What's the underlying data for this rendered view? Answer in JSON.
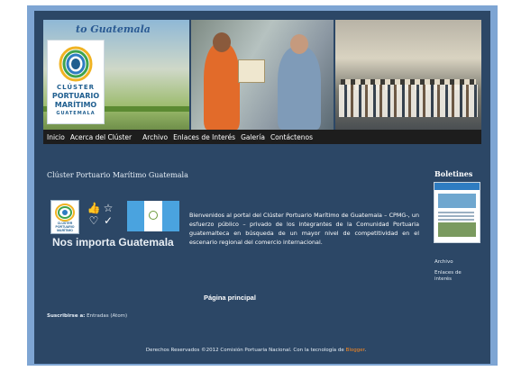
{
  "banner": {
    "sign_text": "to Guatemala",
    "logo_lines": [
      "CLÚSTER",
      "PORTUARIO",
      "MARÍTIMO",
      "GUATEMALA"
    ]
  },
  "nav": {
    "items": [
      "Inicio",
      "Acerca del Clúster",
      "Archivo",
      "Enlaces de Interés",
      "Galería",
      "Contáctenos"
    ]
  },
  "post": {
    "title": "Clúster Portuario Marítimo Guatemala",
    "slogan": "Nos importa Guatemala",
    "promo_logo_lines": [
      "CLÚSTER",
      "PORTUARIO",
      "MARÍTIMO"
    ],
    "intro": "Bienvenidos al portal del Clúster Portuario Marítimo de Guatemala – CPMG-, un esfuerzo público – privado de los integrantes de la Comunidad Portuaria guatemalteca en búsqueda de un mayor nivel de competitividad en el escenario regional del comercio internacional."
  },
  "sidebar": {
    "title": "Boletines",
    "links": [
      "Archivo",
      "Enlaces de interés"
    ]
  },
  "main_page_link": "Página principal",
  "subscribe": {
    "label": "Suscribirse a:",
    "link": "Entradas (Atom)"
  },
  "footer": {
    "text": "Derechos Reservados ©2012 Comisión Portuaria Nacional. Con la tecnología de",
    "link": "Blogger",
    "end": "."
  },
  "colors": {
    "page_bg": "#2c4766",
    "frame": "#7ea5d3",
    "nav_bg": "#1d1d1d",
    "footer_link": "#ff8a1d",
    "flag_blue": "#4aa3df"
  }
}
